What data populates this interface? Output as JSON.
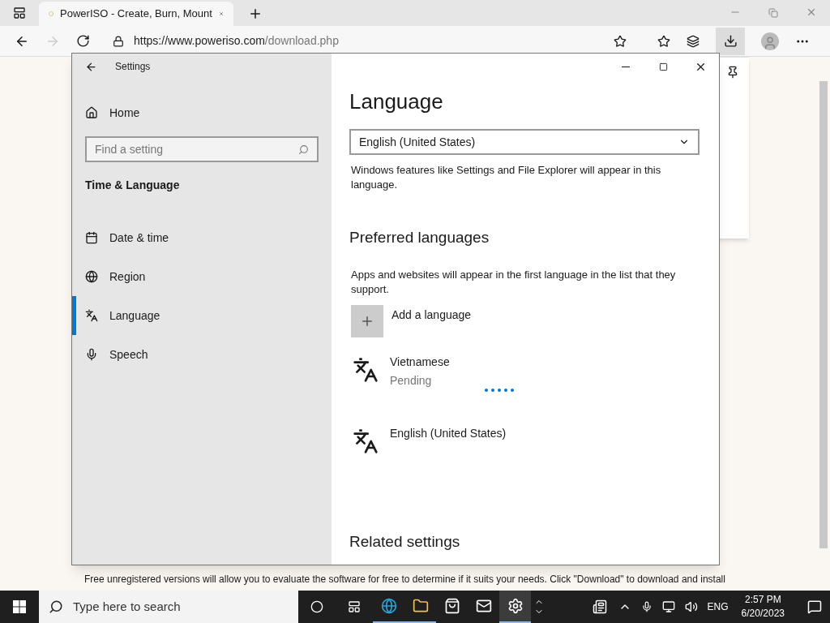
{
  "browser": {
    "tab_title": "PowerISO - Create, Burn, Mount",
    "url": {
      "host": "https://www.poweriso.com",
      "path": "/download.php"
    },
    "footer_text": "Free unregistered versions will allow you to evaluate the software for free to determine if it suits your needs. Click \"Download\" to download and install"
  },
  "settings": {
    "title": "Settings",
    "home": "Home",
    "search": {
      "placeholder": "Find a setting"
    },
    "section": "Time & Language",
    "nav": [
      {
        "kind": "calendar",
        "label": "Date & time",
        "selected": false
      },
      {
        "kind": "globe",
        "label": "Region",
        "selected": false
      },
      {
        "kind": "language",
        "label": "Language",
        "selected": true
      },
      {
        "kind": "mic",
        "label": "Speech",
        "selected": false
      }
    ],
    "heading": "Language",
    "display_language": "English (United States)",
    "display_desc": "Windows features like Settings and File Explorer will appear in this language.",
    "preferred_heading": "Preferred languages",
    "preferred_desc": "Apps and websites will appear in the first language in the list that they support.",
    "add_label": "Add a language",
    "languages": [
      {
        "name": "Vietnamese",
        "status": "Pending",
        "loading": true
      },
      {
        "name": "English (United States)",
        "loading": false
      }
    ],
    "related_heading": "Related settings"
  },
  "taskbar": {
    "search_placeholder": "Type here to search",
    "apps": [
      {
        "kind": "edge",
        "running": true,
        "selected": false
      },
      {
        "kind": "folder",
        "running": true,
        "selected": false
      },
      {
        "kind": "store",
        "running": false,
        "selected": false
      },
      {
        "kind": "mail",
        "running": false,
        "selected": false
      },
      {
        "kind": "gear",
        "running": true,
        "selected": true
      }
    ],
    "language": "ENG",
    "time": "2:57 PM",
    "date": "6/20/2023"
  }
}
